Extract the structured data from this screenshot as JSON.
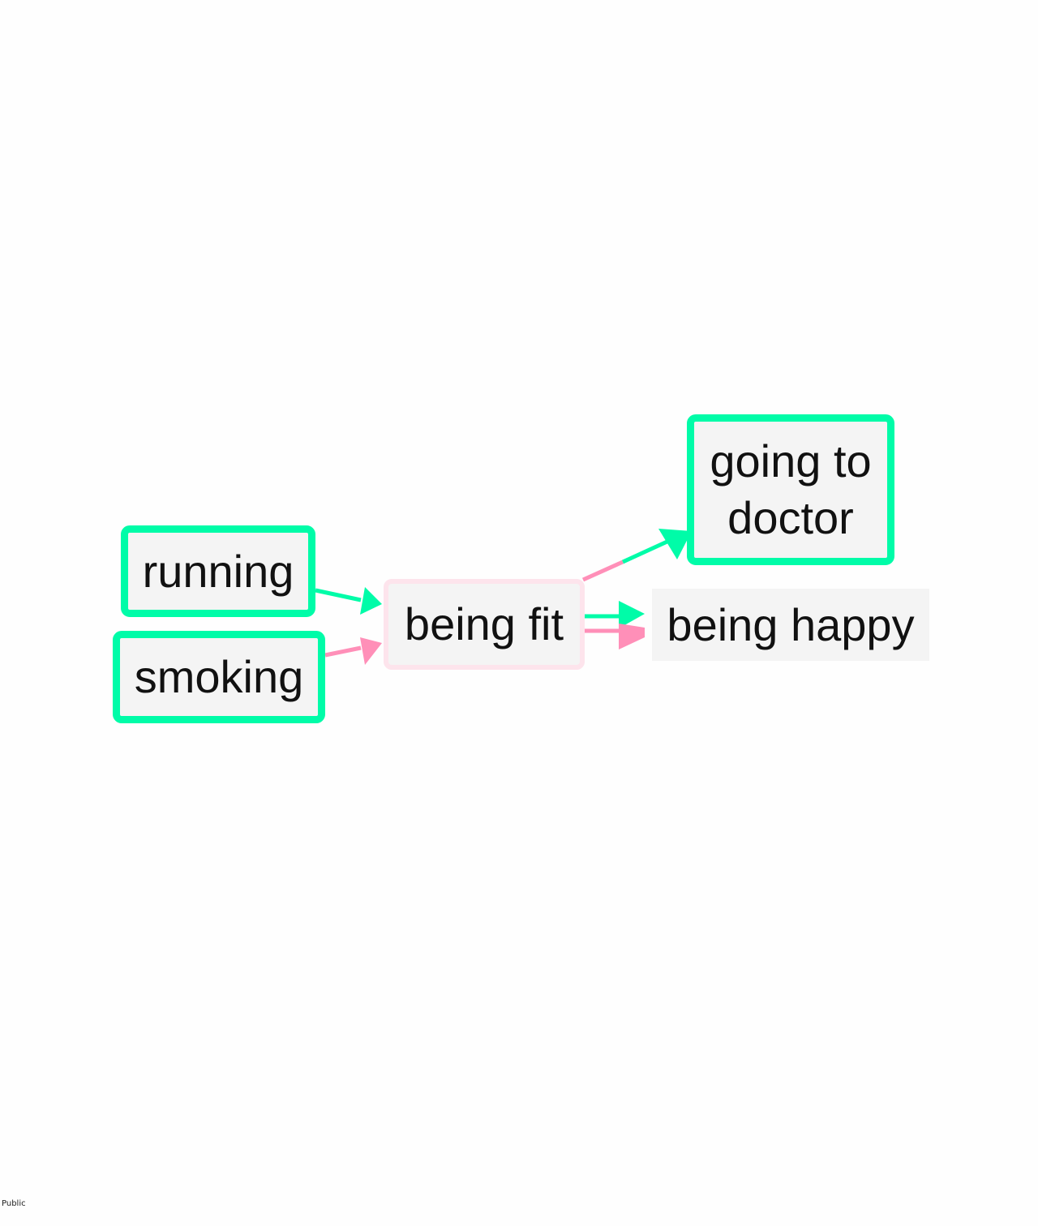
{
  "diagram": {
    "nodes": {
      "running": {
        "label": "running"
      },
      "smoking": {
        "label": "smoking"
      },
      "being_fit": {
        "label": "being fit"
      },
      "going_to_doctor": {
        "line1": "going to",
        "line2": "doctor"
      },
      "being_happy": {
        "label": "being happy"
      }
    },
    "edges": [
      {
        "from": "running",
        "to": "being fit",
        "polarity": "positive"
      },
      {
        "from": "smoking",
        "to": "being fit",
        "polarity": "negative"
      },
      {
        "from": "being fit",
        "to": "going to doctor",
        "polarity": "negative-to-positive"
      },
      {
        "from": "being fit",
        "to": "being happy",
        "polarity": "positive"
      },
      {
        "from": "being fit",
        "to": "being happy",
        "polarity": "negative"
      }
    ],
    "colors": {
      "positive": "#00fca8",
      "negative": "#ff8fb8",
      "soft_border": "#fde4ec",
      "node_fill": "#f4f4f4"
    }
  },
  "footer": {
    "label": "Public"
  }
}
